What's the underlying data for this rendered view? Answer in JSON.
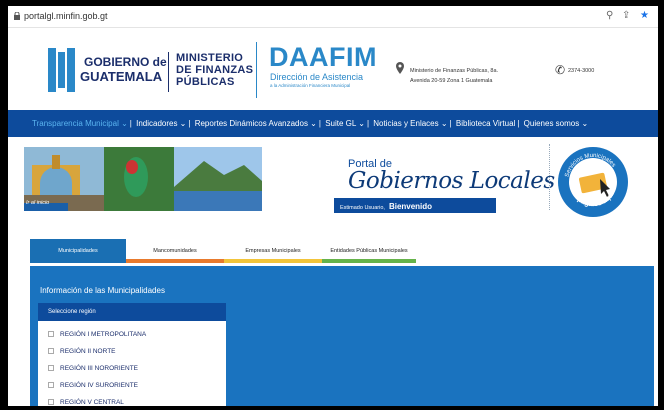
{
  "browser": {
    "url": "portalgl.minfin.gob.gt"
  },
  "header": {
    "gobierno_line1": "GOBIERNO de",
    "gobierno_line2": "GUATEMALA",
    "ministerio_line1": "MINISTERIO",
    "ministerio_line2": "DE FINANZAS",
    "ministerio_line3": "PÚBLICAS",
    "daafim": "DAAFIM",
    "daafim_sub1": "Dirección de Asistencia",
    "daafim_sub2": "a la Administración Financiera Municipal",
    "address_line1": "Ministerio de Finanzas Públicas, 8a.",
    "address_line2": "Avenida 20-59 Zona 1 Guatemala",
    "phone": "2374-3000"
  },
  "nav": {
    "items": [
      "Transparencia Municipal ⌄",
      "Indicadores ⌄",
      "Reportes Dinámicos Avanzados ⌄",
      "Suite GL ⌄",
      "Noticias y Enlaces ⌄",
      "Biblioteca Virtual",
      "Quienes somos ⌄"
    ]
  },
  "banner": {
    "link": "Ir al inicio",
    "portal_de": "Portal de",
    "portal_title": "Gobiernos Locales",
    "welcome_prefix": "Estimado Usuario,",
    "welcome": "Bienvenido",
    "badge_top": "Servicios Municipales",
    "badge_bottom": "págalos aquí"
  },
  "tabs": [
    "Municipalidades",
    "Mancomunidades",
    "Empresas Municipales",
    "Entidades Públicas Municipales"
  ],
  "panel": {
    "title": "Información de las Municipalidades",
    "select_label": "Seleccione región",
    "regions": [
      "REGIÓN I METROPOLITANA",
      "REGIÓN II NORTE",
      "REGIÓN III NORORIENTE",
      "REGIÓN IV SURORIENTE",
      "REGIÓN V CENTRAL"
    ]
  }
}
